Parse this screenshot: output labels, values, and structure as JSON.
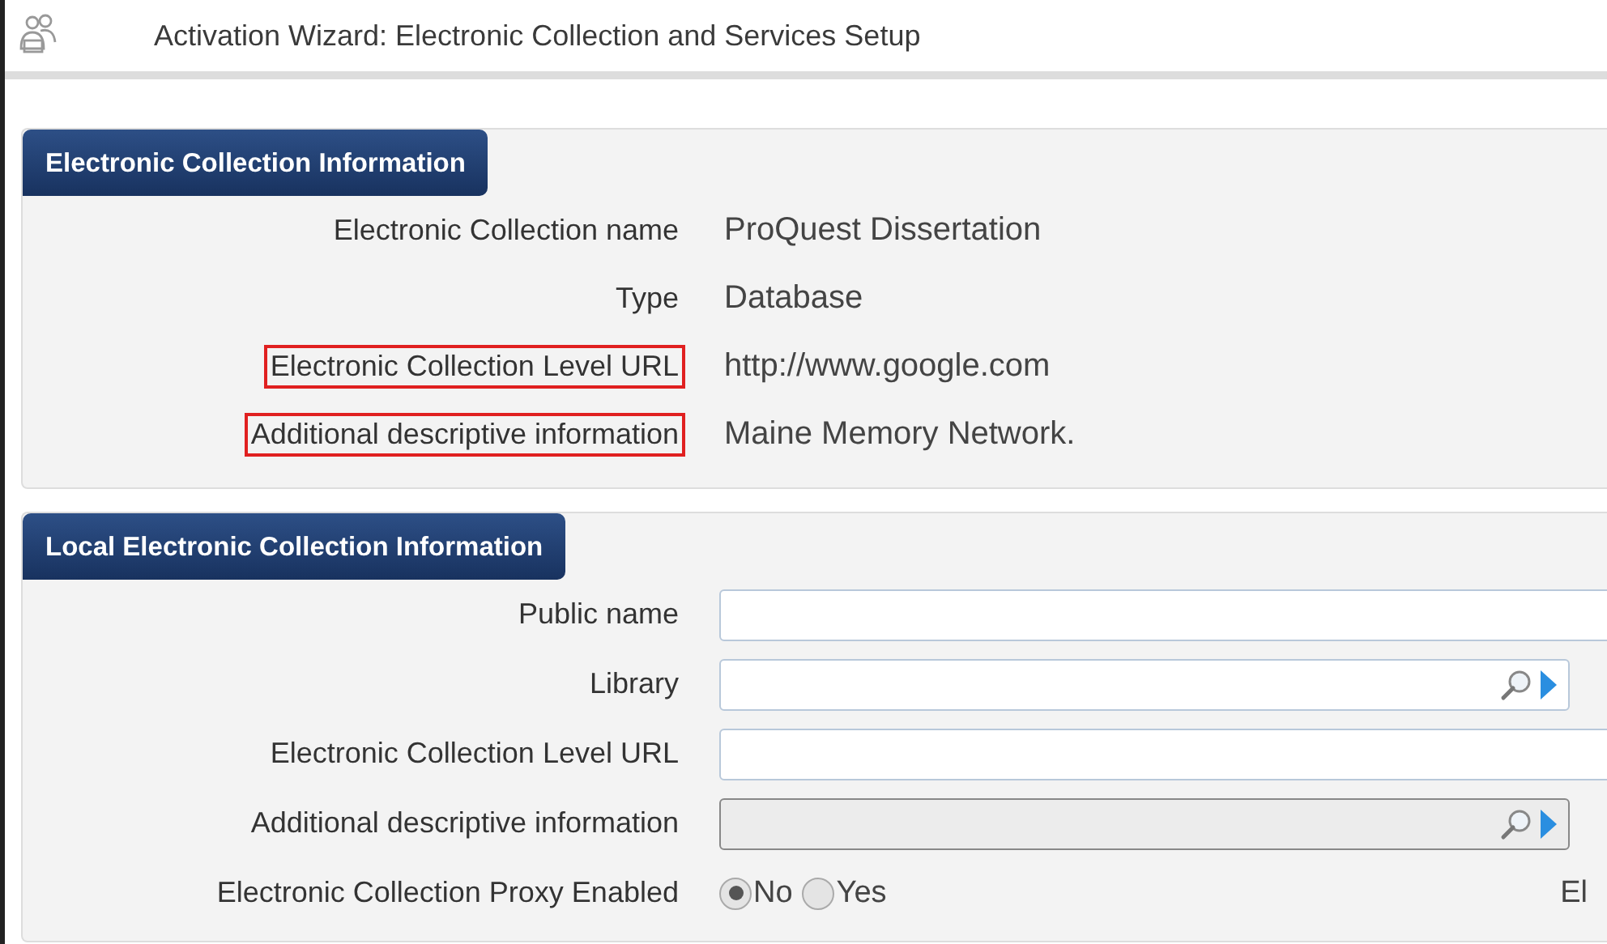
{
  "window": {
    "title": "Activation Wizard: Electronic Collection and Services Setup"
  },
  "info_section": {
    "title": "Electronic Collection Information",
    "rows": [
      {
        "label": "Electronic Collection name",
        "value": "ProQuest Dissertation",
        "highlighted": false
      },
      {
        "label": "Type",
        "value": "Database",
        "highlighted": false
      },
      {
        "label": "Electronic Collection Level URL",
        "value": "http://www.google.com",
        "highlighted": true
      },
      {
        "label": "Additional descriptive information",
        "value": "Maine Memory Network.",
        "highlighted": true
      }
    ]
  },
  "local_section": {
    "title": "Local Electronic Collection Information",
    "rows": [
      {
        "label": "Public name",
        "kind": "text",
        "disabled": false
      },
      {
        "label": "Library",
        "kind": "lookup",
        "disabled": false
      },
      {
        "label": "Electronic Collection Level URL",
        "kind": "text",
        "disabled": false
      },
      {
        "label": "Additional descriptive information",
        "kind": "lookup",
        "disabled": true
      },
      {
        "label": "Electronic Collection Proxy Enabled",
        "kind": "radio",
        "options": [
          {
            "label": "No",
            "selected": true
          },
          {
            "label": "Yes",
            "selected": false
          }
        ],
        "trailing": "El"
      }
    ]
  }
}
